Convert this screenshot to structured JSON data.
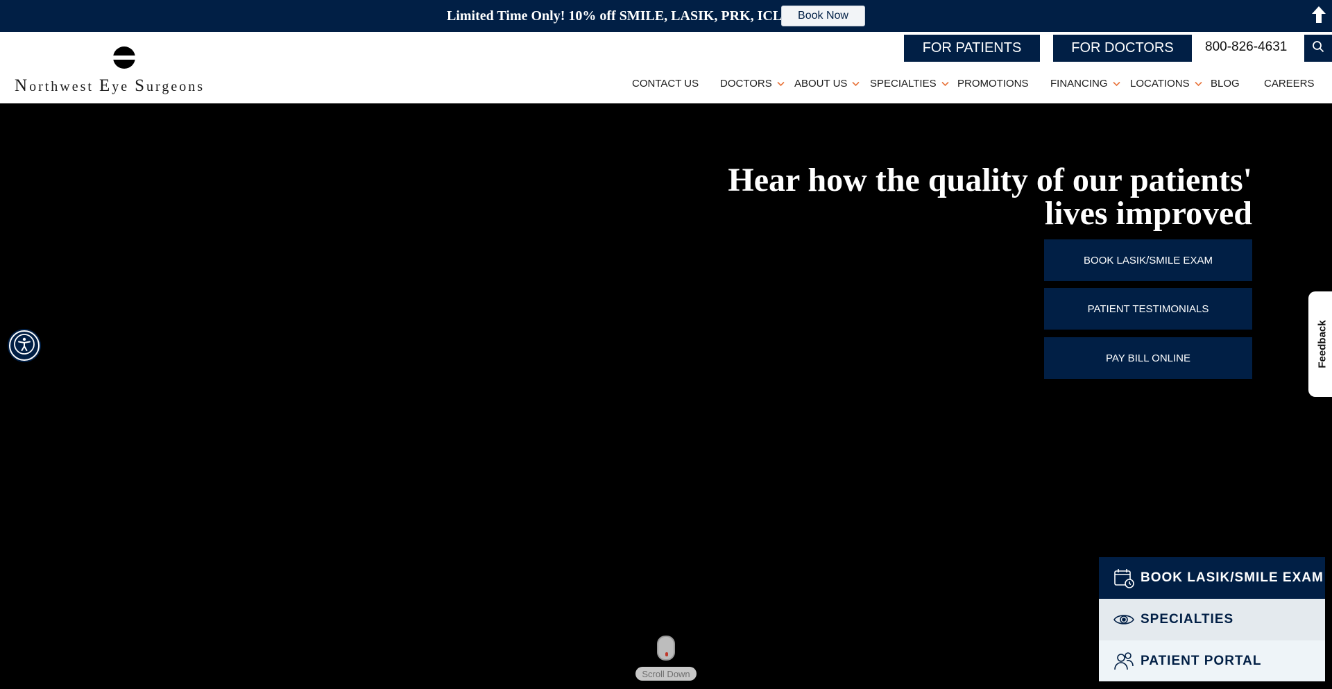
{
  "promo": {
    "text": "Limited Time Only! 10% off SMILE, LASIK, PRK, ICL",
    "button": "Book Now"
  },
  "header": {
    "logo": {
      "n": "N",
      "rest1": "orthwest",
      "e": "E",
      "rest2": "ye",
      "s": "S",
      "rest3": "urgeons"
    },
    "for_patients": "FOR PATIENTS",
    "for_doctors": "FOR DOCTORS",
    "phone": "800-826-4631"
  },
  "nav": [
    {
      "label": "CONTACT US",
      "dropdown": false
    },
    {
      "label": "DOCTORS",
      "dropdown": true
    },
    {
      "label": "ABOUT US",
      "dropdown": true
    },
    {
      "label": "SPECIALTIES",
      "dropdown": true
    },
    {
      "label": "PROMOTIONS",
      "dropdown": false
    },
    {
      "label": "FINANCING",
      "dropdown": true
    },
    {
      "label": "LOCATIONS",
      "dropdown": true
    },
    {
      "label": "BLOG",
      "dropdown": false
    },
    {
      "label": "CAREERS",
      "dropdown": false
    }
  ],
  "hero": {
    "title_line1": "Hear how the quality of our patients'",
    "title_line2": "lives improved",
    "buttons": [
      "BOOK LASIK/SMILE EXAM",
      "PATIENT TESTIMONIALS",
      "PAY BILL ONLINE"
    ],
    "scroll_label": "Scroll Down"
  },
  "feedback": "Feedback",
  "cta": [
    {
      "label": "BOOK LASIK/SMILE EXAM",
      "icon": "calendar-clock-icon"
    },
    {
      "label": "SPECIALTIES",
      "icon": "eye-icon"
    },
    {
      "label": "PATIENT PORTAL",
      "icon": "users-icon"
    }
  ],
  "colors": {
    "navy": "#011f45",
    "accent_chevron": "#e8733a"
  }
}
